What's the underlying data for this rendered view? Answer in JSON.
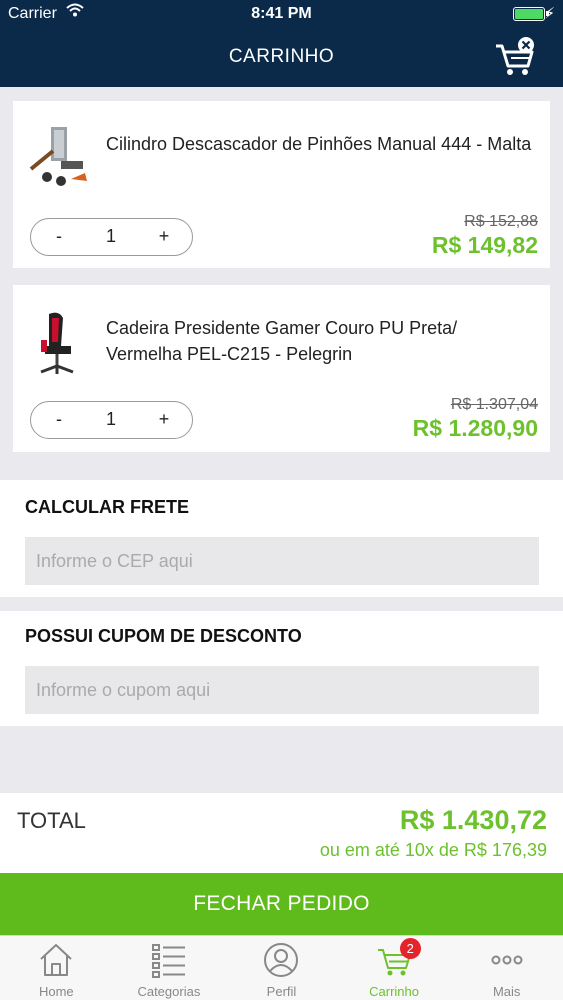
{
  "status": {
    "carrier": "Carrier",
    "time": "8:41 PM"
  },
  "header": {
    "title": "CARRINHO",
    "clear_icon": "cart-remove-icon"
  },
  "cart": {
    "items": [
      {
        "name": "Cilindro Descascador de Pinhões Manual 444 - Malta",
        "qty": "1",
        "old_price": "R$ 152,88",
        "price": "R$ 149,82",
        "minus": "-",
        "plus": "+"
      },
      {
        "name": "Cadeira Presidente Gamer Couro PU Preta/ Vermelha PEL-C215 - Pelegrin",
        "qty": "1",
        "old_price": "R$ 1.307,04",
        "price": "R$ 1.280,90",
        "minus": "-",
        "plus": "+"
      }
    ]
  },
  "shipping": {
    "label": "CALCULAR FRETE",
    "placeholder": "Informe o CEP aqui"
  },
  "coupon": {
    "label": "POSSUI CUPOM DE DESCONTO",
    "placeholder": "Informe o cupom aqui"
  },
  "total": {
    "label": "TOTAL",
    "value": "R$ 1.430,72",
    "installments": "ou em até 10x de R$ 176,39"
  },
  "checkout": {
    "label": "FECHAR PEDIDO"
  },
  "tabs": [
    {
      "label": "Home",
      "icon": "home-icon"
    },
    {
      "label": "Categorias",
      "icon": "list-icon"
    },
    {
      "label": "Perfil",
      "icon": "user-icon"
    },
    {
      "label": "Carrinho",
      "icon": "cart-icon",
      "badge": "2"
    },
    {
      "label": "Mais",
      "icon": "more-icon"
    }
  ],
  "colors": {
    "header": "#0b2a4a",
    "accent": "#6cc12d",
    "checkout": "#5fba1b",
    "badge": "#e3242b"
  }
}
